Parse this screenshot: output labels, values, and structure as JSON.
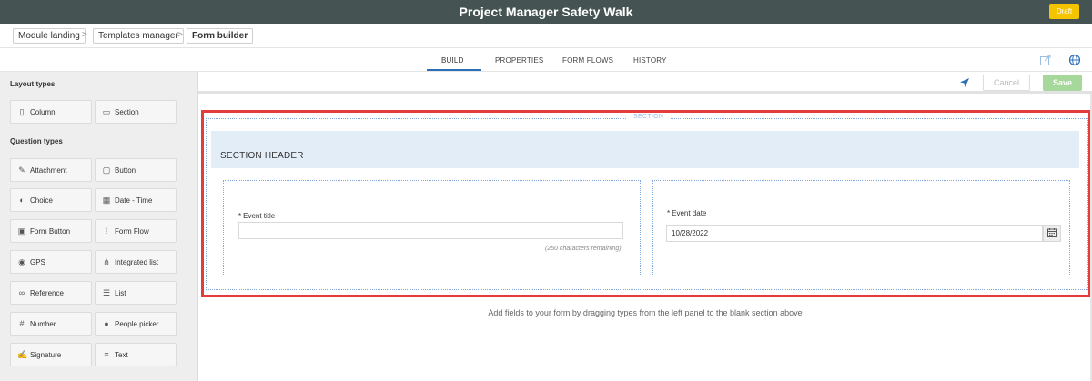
{
  "app": {
    "title": "Project Manager Safety Walk",
    "status_badge": "Draft"
  },
  "breadcrumb": {
    "items": [
      "Module landing",
      "Templates manager",
      "Form builder"
    ],
    "separator": ">"
  },
  "tabs": [
    {
      "label": "BUILD",
      "active": true
    },
    {
      "label": "PROPERTIES",
      "active": false
    },
    {
      "label": "FORM FLOWS",
      "active": false
    },
    {
      "label": "HISTORY",
      "active": false
    }
  ],
  "tab_icons": [
    "external-edit-icon",
    "globe-icon"
  ],
  "left_panel": {
    "layout_heading": "Layout types",
    "layout_types": [
      {
        "label": "Column",
        "icon": "column-icon"
      },
      {
        "label": "Section",
        "icon": "section-icon"
      }
    ],
    "question_heading": "Question types",
    "question_types": [
      {
        "label": "Attachment",
        "icon": "paperclip-icon"
      },
      {
        "label": "Button",
        "icon": "button-icon"
      },
      {
        "label": "Choice",
        "icon": "toggle-icon"
      },
      {
        "label": "Date - Time",
        "icon": "calendar-clock-icon"
      },
      {
        "label": "Form Button",
        "icon": "form-button-icon"
      },
      {
        "label": "Form Flow",
        "icon": "form-flow-icon"
      },
      {
        "label": "GPS",
        "icon": "location-pin-icon"
      },
      {
        "label": "Integrated list",
        "icon": "integrated-list-icon"
      },
      {
        "label": "Reference",
        "icon": "link-icon"
      },
      {
        "label": "List",
        "icon": "list-icon"
      },
      {
        "label": "Number",
        "icon": "hash-icon"
      },
      {
        "label": "People picker",
        "icon": "person-icon"
      },
      {
        "label": "Signature",
        "icon": "signature-icon"
      },
      {
        "label": "Text",
        "icon": "text-lines-icon"
      }
    ]
  },
  "toolbar": {
    "cancel_label": "Cancel",
    "save_label": "Save",
    "accent": "#2d6fb7",
    "save_color": "#a7d89b"
  },
  "canvas": {
    "section_tag": "SECTION",
    "section_header": "SECTION HEADER",
    "event_title": {
      "required_mark": "*",
      "label": "Event title",
      "value": "",
      "remaining": "(250 characters remaining)"
    },
    "event_date": {
      "required_mark": "*",
      "label": "Event date",
      "value": "10/28/2022"
    },
    "hint": "Add fields to your form by dragging types from the left panel to the blank section above",
    "highlight_color": "#e53b3b"
  }
}
